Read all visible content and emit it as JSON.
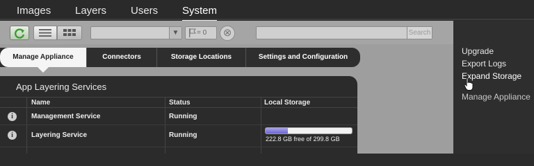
{
  "nav": {
    "tabs": [
      {
        "label": "Images"
      },
      {
        "label": "Layers"
      },
      {
        "label": "Users"
      },
      {
        "label": "System"
      }
    ],
    "active": "System"
  },
  "toolbar": {
    "refresh_icon": "refresh-icon",
    "list_view_icon": "list-view-icon",
    "grid_view_icon": "grid-view-icon",
    "filter_select_value": "",
    "flag_count": "= 0",
    "search_placeholder": "",
    "search_button": "Search"
  },
  "subtabs": [
    {
      "label": "Manage Appliance"
    },
    {
      "label": "Connectors"
    },
    {
      "label": "Storage Locations"
    },
    {
      "label": "Settings and Configuration"
    }
  ],
  "services": {
    "title": "App Layering Services",
    "columns": [
      "Name",
      "Status",
      "Local Storage"
    ],
    "rows": [
      {
        "name": "Management Service",
        "status": "Running",
        "storage": ""
      },
      {
        "name": "Layering Service",
        "status": "Running",
        "storage": "222.8 GB free of 299.8 GB",
        "used_fraction": 0.257
      }
    ]
  },
  "side_menu": {
    "items": [
      {
        "label": "Upgrade"
      },
      {
        "label": "Export Logs"
      },
      {
        "label": "Expand Storage"
      },
      {
        "label": "Manage Appliance"
      }
    ]
  },
  "colors": {
    "accent_refresh": "#4caa3c",
    "storage_fill": "#7d76dc"
  }
}
